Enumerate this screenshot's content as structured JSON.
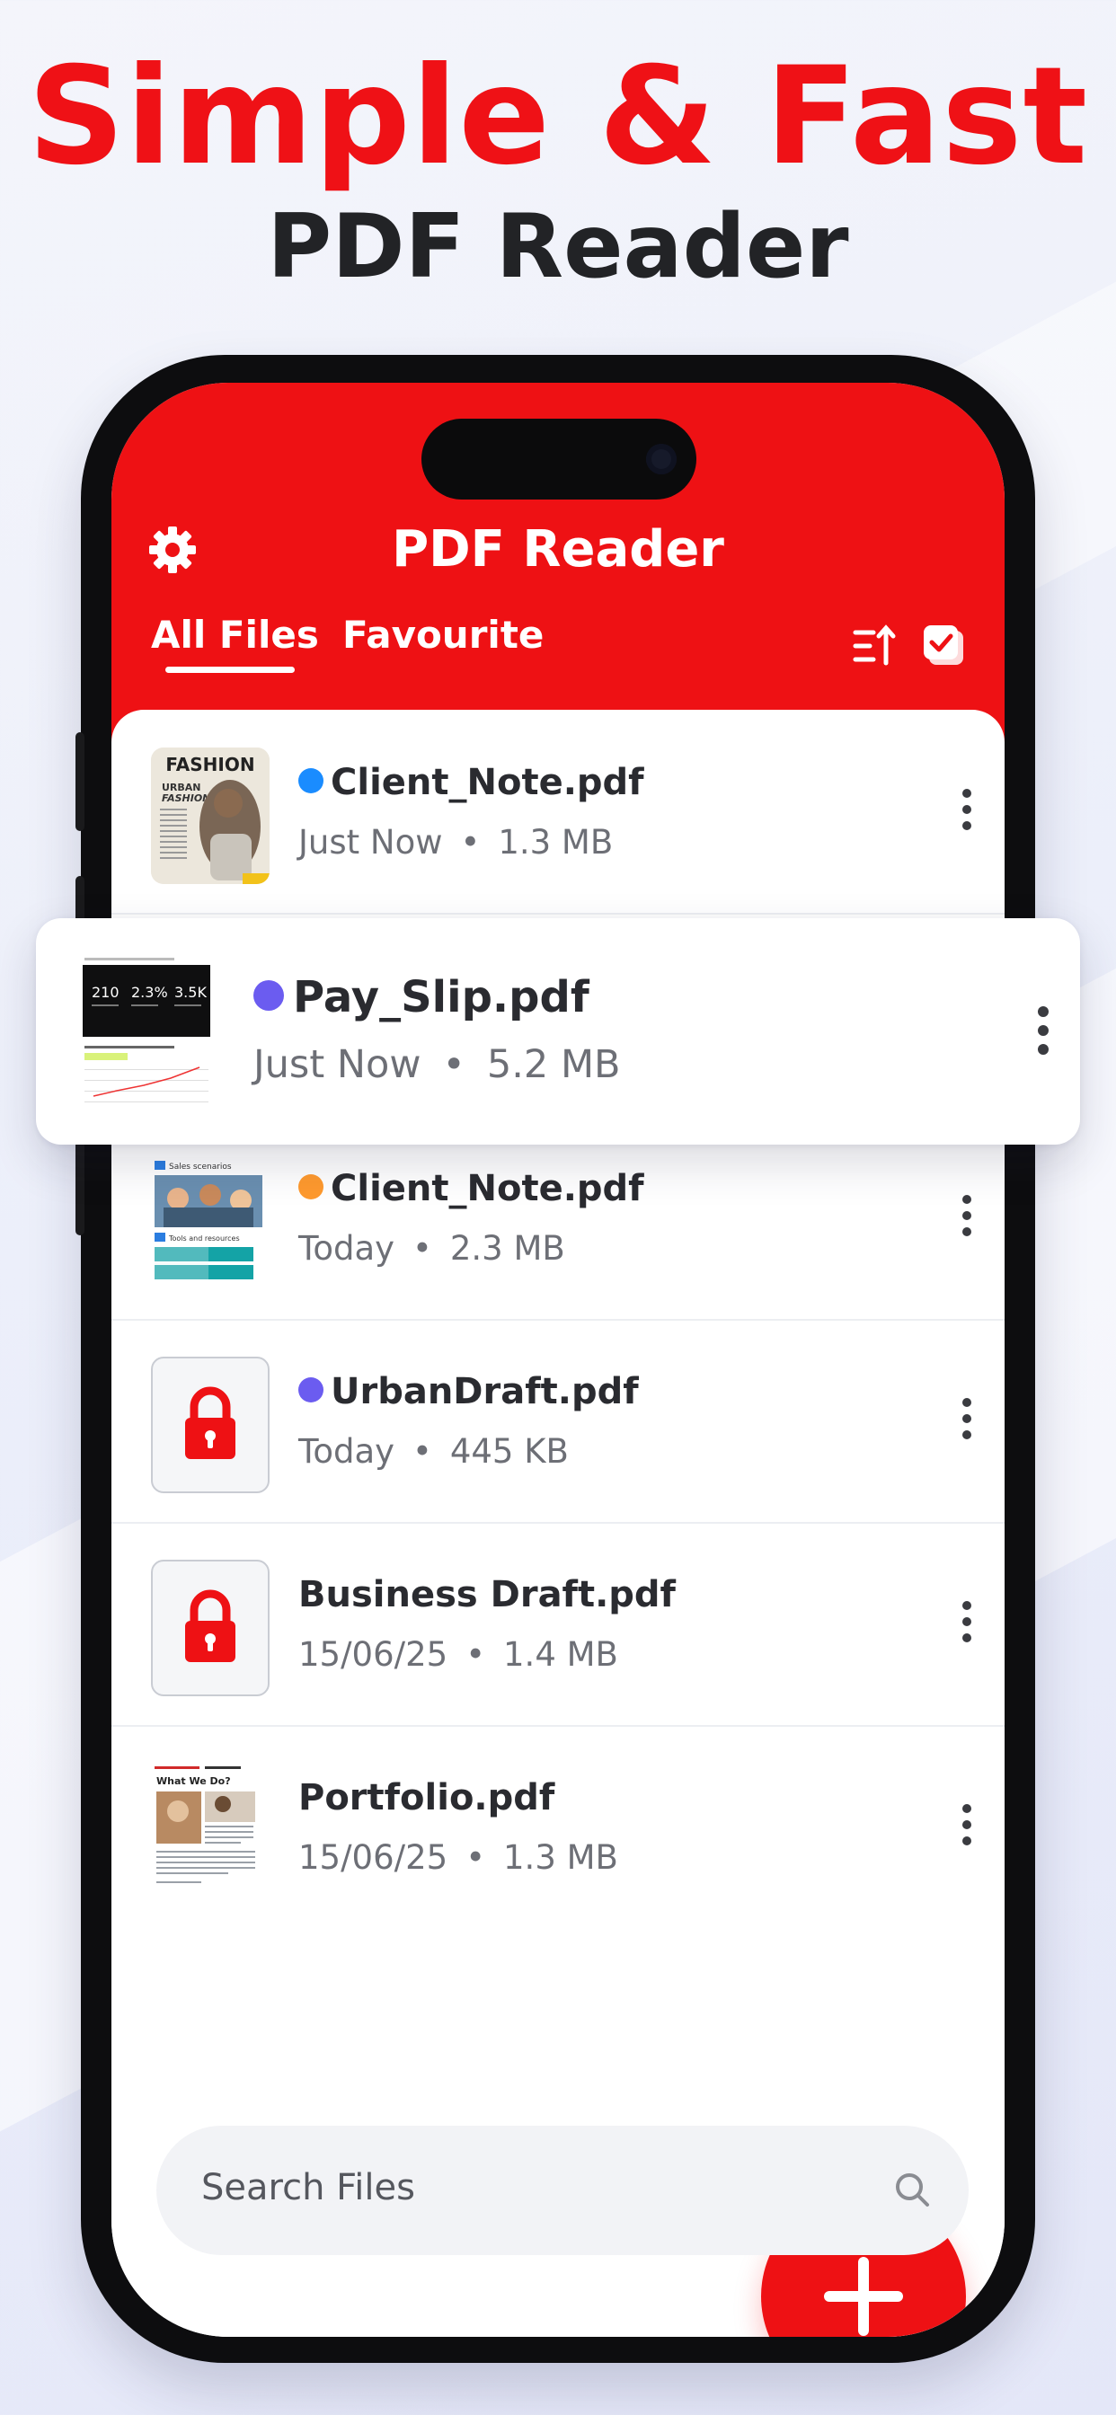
{
  "promo": {
    "headline": "Simple & Fast",
    "subheadline": "PDF Reader"
  },
  "app": {
    "title": "PDF Reader",
    "tabs": [
      {
        "label": "All Files",
        "active": true
      },
      {
        "label": "Favourite",
        "active": false
      }
    ],
    "icons": {
      "settings": "gear-icon",
      "sort": "sort-icon",
      "select": "select-all-icon",
      "more": "more-vertical-icon",
      "lock": "lock-icon",
      "add": "plus-icon",
      "search": "search-icon"
    },
    "colors": {
      "brand": "#ee1114",
      "dot_blue": "#1a8cff",
      "dot_purple": "#6b5cf0",
      "dot_orange": "#ff9a2e"
    }
  },
  "files": [
    {
      "name": "Client_Note.pdf",
      "date": "Just Now",
      "size": "1.3 MB",
      "dot": "#1a8cff",
      "thumb": "fashion"
    },
    {
      "name": "Pay_Slip.pdf",
      "date": "Just Now",
      "size": "5.2 MB",
      "dot": "#6b5cf0",
      "thumb": "report"
    },
    {
      "name": "Client_Note.pdf",
      "date": "Today",
      "size": "2.3 MB",
      "dot": "#ff9a2e",
      "thumb": "sales"
    },
    {
      "name": "UrbanDraft.pdf",
      "date": "Today",
      "size": "445 KB",
      "dot": "#6b5cf0",
      "thumb": "locked"
    },
    {
      "name": "Business Draft.pdf",
      "date": "15/06/25",
      "size": "1.4 MB",
      "dot": "",
      "thumb": "locked"
    },
    {
      "name": "Portfolio.pdf",
      "date": "15/06/25",
      "size": "1.3 MB",
      "dot": "",
      "thumb": "portfolio"
    }
  ],
  "meta_separator": "•",
  "thumbs": {
    "fashion_title": "FASHION",
    "fashion_sub": "URBAN FASHION",
    "report_stats": [
      "210",
      "2.3%",
      "3.5K"
    ],
    "sales_heading": "Sales scenarios",
    "sales_sub": "Tools and resources",
    "portfolio_heading": "What We Do?"
  },
  "search": {
    "placeholder": "Search Files"
  }
}
